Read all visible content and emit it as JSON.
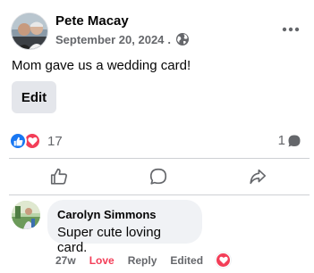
{
  "post": {
    "author": "Pete Macay",
    "date": "September 20, 2024",
    "separator": ".",
    "audience_icon": "globe-icon",
    "text": "Mom gave us a wedding card!",
    "edit_label": "Edit"
  },
  "engagement": {
    "reactions": [
      "like-icon",
      "love-icon"
    ],
    "reaction_count": "17",
    "comment_count": "1"
  },
  "actions": [
    "like-icon",
    "comment-icon",
    "share-icon"
  ],
  "comment": {
    "author": "Carolyn Simmons",
    "text": "Super cute loving card.",
    "time": "27w",
    "reacted_label": "Love",
    "reply_label": "Reply",
    "edited_label": "Edited",
    "reaction_icon": "love-icon"
  },
  "colors": {
    "facebook_blue": "#1877f2",
    "love_red": "#f33e58",
    "secondary_text": "#65676b",
    "bubble_bg": "#f0f2f5",
    "button_bg": "#e4e6eb"
  }
}
